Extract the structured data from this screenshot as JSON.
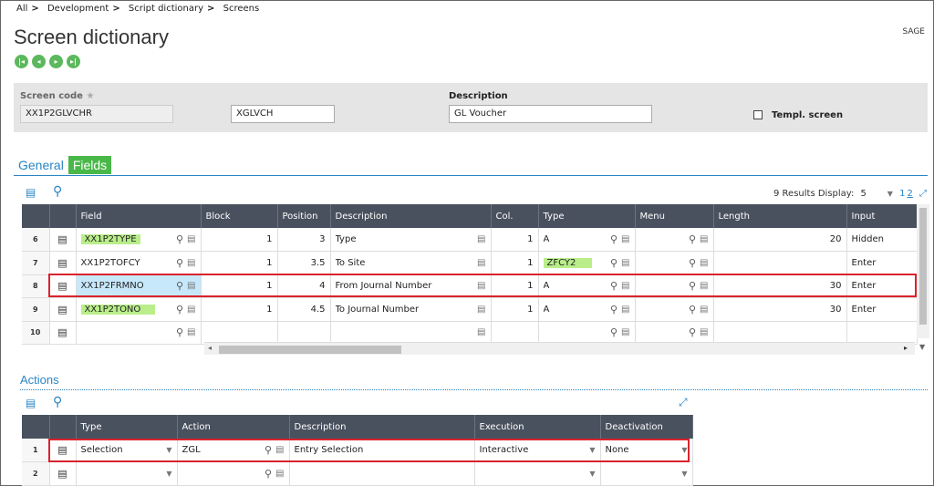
{
  "breadcrumb": [
    "All",
    "Development",
    "Script dictionary",
    "Screens"
  ],
  "page_title": "Screen dictionary",
  "brand": "SAGE",
  "header": {
    "screen_code_label": "Screen code",
    "screen_code_value": "XX1P2GLVCHR",
    "abbrev_value": "XGLVCH",
    "description_label": "Description",
    "description_value": "GL Voucher",
    "templ_label": "Templ. screen"
  },
  "tabs": [
    "General",
    "Fields"
  ],
  "fields_grid": {
    "results": "9 Results",
    "display_label": "Display:",
    "display_value": "5",
    "pages": [
      "1",
      "2"
    ],
    "columns": [
      "Field",
      "Block",
      "Position",
      "Description",
      "Col.",
      "Type",
      "Menu",
      "Length",
      "Input"
    ],
    "rows": [
      {
        "no": "6",
        "field": "XX1P2TYPE",
        "block": "1",
        "position": "3",
        "description": "Type",
        "col": "1",
        "type": "A",
        "menu": "",
        "length": "20",
        "input": "Hidden"
      },
      {
        "no": "7",
        "field": "XX1P2TOFCY",
        "block": "1",
        "position": "3.5",
        "description": "To Site",
        "col": "1",
        "type": "ZFCY2",
        "menu": "",
        "length": "",
        "input": "Enter"
      },
      {
        "no": "8",
        "field": "XX1P2FRMNO",
        "block": "1",
        "position": "4",
        "description": "From Journal Number",
        "col": "1",
        "type": "A",
        "menu": "",
        "length": "30",
        "input": "Enter"
      },
      {
        "no": "9",
        "field": "XX1P2TONO",
        "block": "1",
        "position": "4.5",
        "description": "To Journal Number",
        "col": "1",
        "type": "A",
        "menu": "",
        "length": "30",
        "input": "Enter"
      },
      {
        "no": "10",
        "field": "",
        "block": "",
        "position": "",
        "description": "",
        "col": "",
        "type": "",
        "menu": "",
        "length": "",
        "input": ""
      }
    ]
  },
  "actions": {
    "title": "Actions",
    "columns": [
      "Type",
      "Action",
      "Description",
      "Execution",
      "Deactivation"
    ],
    "rows": [
      {
        "no": "1",
        "type": "Selection",
        "action": "ZGL",
        "description": "Entry Selection",
        "execution": "Interactive",
        "deactivation": "None"
      },
      {
        "no": "2",
        "type": "",
        "action": "",
        "description": "",
        "execution": "",
        "deactivation": ""
      }
    ]
  }
}
